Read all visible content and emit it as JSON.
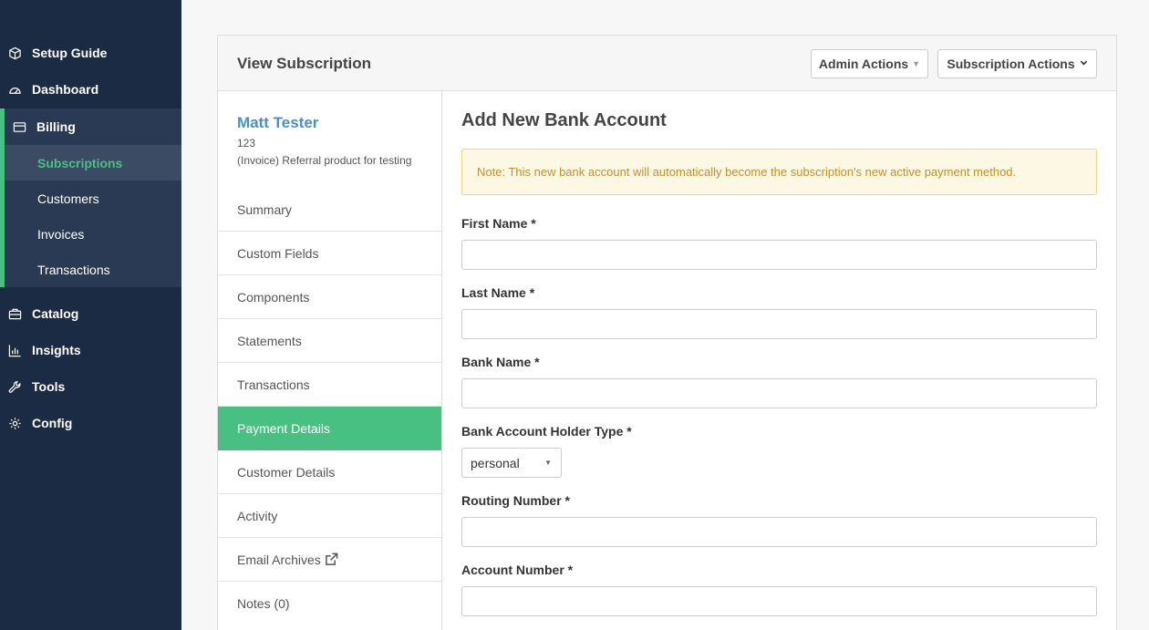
{
  "sidebar": {
    "items": [
      {
        "label": "Setup Guide",
        "icon": "box-icon"
      },
      {
        "label": "Dashboard",
        "icon": "gauge-icon"
      },
      {
        "label": "Billing",
        "icon": "credit-card-icon"
      },
      {
        "label": "Catalog",
        "icon": "briefcase-icon"
      },
      {
        "label": "Insights",
        "icon": "bar-chart-icon"
      },
      {
        "label": "Tools",
        "icon": "wrench-icon"
      },
      {
        "label": "Config",
        "icon": "gear-icon"
      }
    ],
    "billing_sub": [
      {
        "label": "Subscriptions",
        "active": true
      },
      {
        "label": "Customers"
      },
      {
        "label": "Invoices"
      },
      {
        "label": "Transactions"
      }
    ],
    "accent": "#48c081"
  },
  "header": {
    "title": "View Subscription",
    "admin_actions": "Admin Actions",
    "subscription_actions": "Subscription Actions"
  },
  "subscription": {
    "customer_name": "Matt Tester",
    "id": "123",
    "product": "(Invoice) Referral product for testing"
  },
  "left_nav": [
    {
      "label": "Summary"
    },
    {
      "label": "Custom Fields"
    },
    {
      "label": "Components"
    },
    {
      "label": "Statements"
    },
    {
      "label": "Transactions"
    },
    {
      "label": "Payment Details",
      "active": true
    },
    {
      "label": "Customer Details"
    },
    {
      "label": "Activity"
    },
    {
      "label": "Email Archives",
      "icon": "external-link-icon"
    },
    {
      "label": "Notes (0)"
    }
  ],
  "form": {
    "title": "Add New Bank Account",
    "note": "Note: This new bank account will automatically become the subscription's new active payment method.",
    "first_name_label": "First Name *",
    "last_name_label": "Last Name *",
    "bank_name_label": "Bank Name *",
    "holder_type_label": "Bank Account Holder Type *",
    "holder_type_value": "personal",
    "routing_label": "Routing Number *",
    "account_label": "Account Number *"
  }
}
